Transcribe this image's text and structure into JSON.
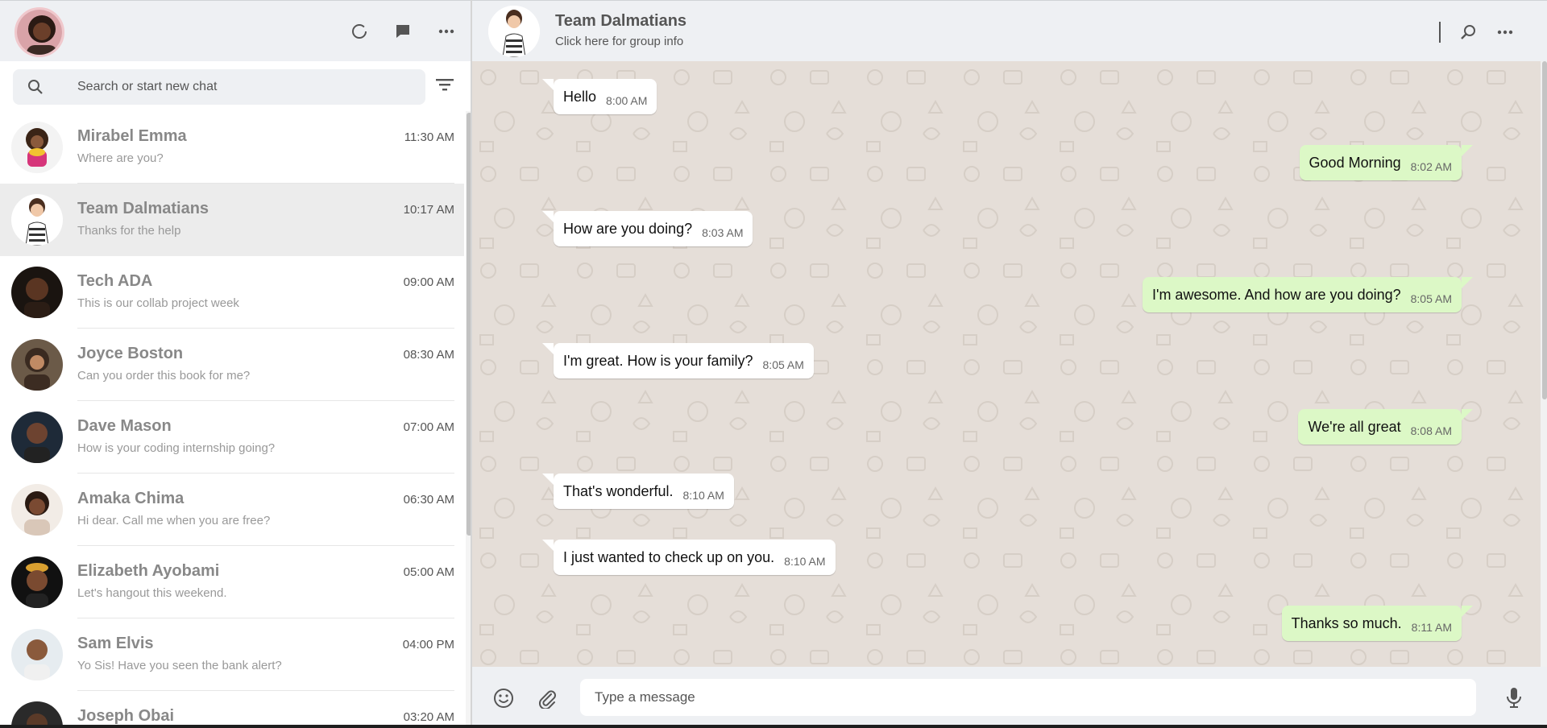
{
  "colors": {
    "accent_out_bubble": "#dcf8c6",
    "in_bubble": "#ffffff",
    "panel_header": "#eef0f3",
    "chat_bg": "#e5ded8"
  },
  "left_header": {
    "icons": [
      "status-icon",
      "new-chat-icon",
      "menu-icon"
    ]
  },
  "search": {
    "placeholder": "Search or start new chat"
  },
  "chats": [
    {
      "name": "Mirabel Emma",
      "last": "Where are you?",
      "time": "11:30 AM"
    },
    {
      "name": "Team Dalmatians",
      "last": "Thanks for the help",
      "time": "10:17 AM"
    },
    {
      "name": "Tech ADA",
      "last": "This is our collab project week",
      "time": "09:00 AM"
    },
    {
      "name": "Joyce Boston",
      "last": "Can you order this book for me?",
      "time": "08:30 AM"
    },
    {
      "name": "Dave Mason",
      "last": "How is your coding internship going?",
      "time": "07:00 AM"
    },
    {
      "name": "Amaka Chima",
      "last": "Hi dear. Call me when you are free?",
      "time": "06:30 AM"
    },
    {
      "name": "Elizabeth Ayobami",
      "last": "Let's hangout this weekend.",
      "time": "05:00 AM"
    },
    {
      "name": "Sam Elvis",
      "last": "Yo Sis! Have you seen the bank alert?",
      "time": "04:00 PM"
    },
    {
      "name": "Joseph Obai",
      "last": "",
      "time": "03:20 AM"
    }
  ],
  "conversation": {
    "title": "Team Dalmatians",
    "subtitle": "Click here for group info",
    "messages": [
      {
        "dir": "in",
        "text": "Hello",
        "time": "8:00 AM"
      },
      {
        "dir": "out",
        "text": "Good Morning",
        "time": "8:02 AM"
      },
      {
        "dir": "in",
        "text": "How are you doing?",
        "time": "8:03 AM"
      },
      {
        "dir": "out",
        "text": "I'm awesome. And how are you doing?",
        "time": "8:05 AM"
      },
      {
        "dir": "in",
        "text": "I'm great. How is your family?",
        "time": "8:05 AM"
      },
      {
        "dir": "out",
        "text": "We're all great",
        "time": "8:08 AM"
      },
      {
        "dir": "in",
        "text": "That's wonderful.",
        "time": "8:10 AM"
      },
      {
        "dir": "in",
        "text": "I just wanted to check up on you.",
        "time": "8:10 AM"
      },
      {
        "dir": "out",
        "text": "Thanks so much.",
        "time": "8:11 AM"
      }
    ]
  },
  "composer": {
    "placeholder": "Type a message"
  }
}
